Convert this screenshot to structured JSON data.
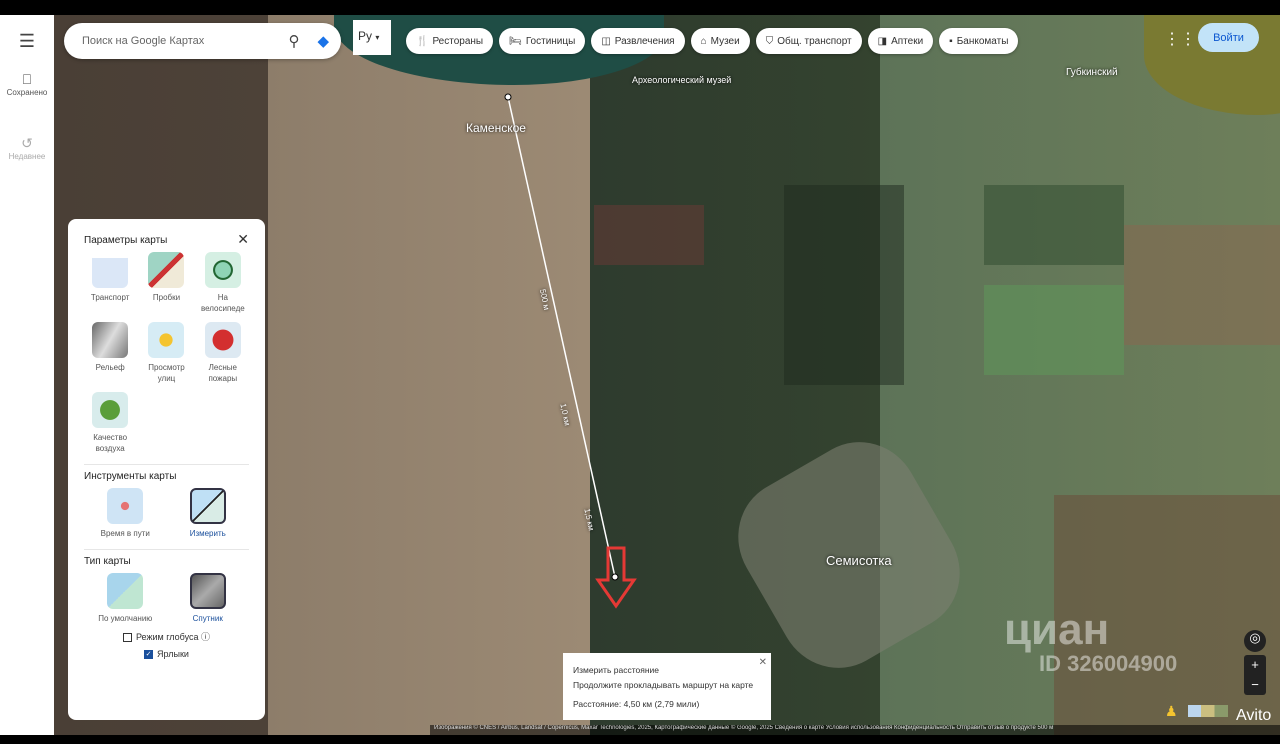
{
  "sidebar": {
    "menu_icon": "menu-icon",
    "saved": "Сохранено",
    "recent": "Недавнее"
  },
  "search": {
    "placeholder": "Поиск на Google Картах"
  },
  "lang": {
    "value": "Ру"
  },
  "chips": [
    {
      "icon": "🍴",
      "label": "Рестораны"
    },
    {
      "icon": "🛏",
      "label": "Гостиницы"
    },
    {
      "icon": "◫",
      "label": "Развлечения"
    },
    {
      "icon": "⌂",
      "label": "Музеи"
    },
    {
      "icon": "⛉",
      "label": "Общ. транспорт"
    },
    {
      "icon": "◨",
      "label": "Аптеки"
    },
    {
      "icon": "▪",
      "label": "Банкоматы"
    }
  ],
  "header": {
    "login": "Войти"
  },
  "map": {
    "labels": {
      "kamenskoe": "Каменское",
      "semisotka": "Семисотка",
      "museum": "Археологический музей",
      "lake": "Губкинский"
    },
    "distances": [
      "500 м",
      "1,0 км",
      "1,5 км",
      "4,50 км"
    ],
    "watermark": "циан",
    "watermark_id": "ID 326004900",
    "avito": "Avito",
    "attribution": "Изображения © CNES / Airbus, Landsat / Copernicus, Maxar Technologies, 2025, Картографические данные © Google, 2025   Сведения о карте   Условия использования   Конфиденциальность   Отправить отзыв о продукте   500 м"
  },
  "panel": {
    "title": "Параметры карты",
    "layers": [
      {
        "label": "Транспорт",
        "color": "#dbe7f7"
      },
      {
        "label": "Пробки",
        "color": "#cfe8de"
      },
      {
        "label": "На велосипеде",
        "color": "#d5efe3"
      },
      {
        "label": "Рельеф",
        "color": "#8c8c8c"
      },
      {
        "label": "Просмотр улиц",
        "color": "#d6ecf5"
      },
      {
        "label": "Лесные пожары",
        "color": "#dde9f2"
      },
      {
        "label": "Качество воздуха",
        "color": "#d8ecec"
      }
    ],
    "tools_title": "Инструменты карты",
    "tools": [
      {
        "label": "Время в пути"
      },
      {
        "label": "Измерить"
      }
    ],
    "type_title": "Тип карты",
    "types": [
      {
        "label": "По умолчанию"
      },
      {
        "label": "Спутник"
      }
    ],
    "globe": "Режим глобуса",
    "labels_toggle": "Ярлыки",
    "labels_checked": true,
    "globe_checked": false
  },
  "measure": {
    "title": "Измерить расстояние",
    "hint": "Продолжите прокладывать маршрут на карте",
    "distance": "Расстояние: 4,50 км (2,79 мили)"
  }
}
